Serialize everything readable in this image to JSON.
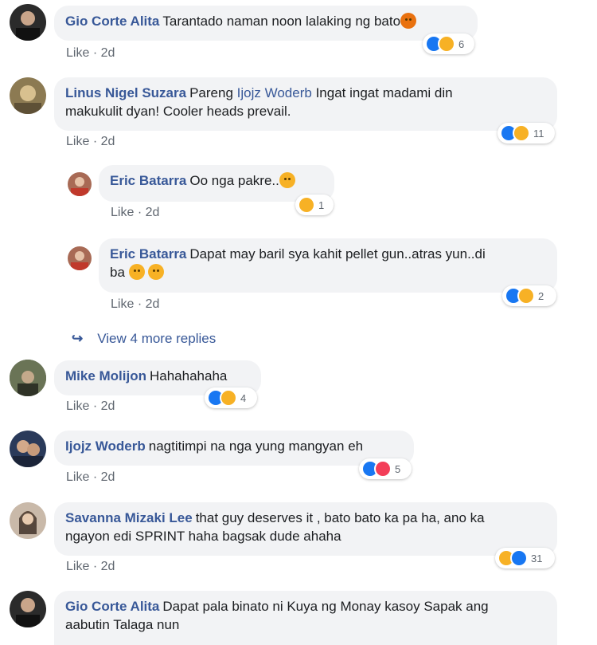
{
  "comments": [
    {
      "name": "Gio Corte Alita",
      "text": "Tarantado naman noon lalaking ng bato",
      "like": "Like",
      "time": "2d",
      "count": "6"
    },
    {
      "name": "Linus Nigel Suzara",
      "pre": "Pareng",
      "mention": "Ijojz Woderb",
      "text": "Ingat ingat madami din",
      "text2": "makukulit dyan! Cooler heads prevail.",
      "like": "Like",
      "time": "2d",
      "count": "11"
    },
    {
      "name": "Eric Batarra",
      "text": "Oo nga pakre..",
      "like": "Like",
      "time": "2d",
      "count": "1"
    },
    {
      "name": "Eric Batarra",
      "text": "Dapat may baril sya kahit pellet gun..atras yun..di",
      "text2": "ba",
      "like": "Like",
      "time": "2d",
      "count": "2"
    },
    {
      "name": "Mike Molijon",
      "text": "Hahahahaha",
      "like": "Like",
      "time": "2d",
      "count": "4"
    },
    {
      "name": "Ijojz Woderb",
      "text": "nagtitimpi na nga yung mangyan eh",
      "like": "Like",
      "time": "2d",
      "count": "5"
    },
    {
      "name": "Savanna Mizaki Lee",
      "text": "that guy deserves it , bato bato ka pa ha, ano ka",
      "text2": "ngayon edi SPRINT haha bagsak dude ahaha",
      "like": "Like",
      "time": "2d",
      "count": "31"
    },
    {
      "name": "Gio Corte Alita",
      "text": "Dapat pala binato ni Kuya ng Monay kasoy Sapak ang",
      "text2": "aabutin Talaga nun"
    }
  ],
  "view_more": {
    "arrow": "↪",
    "label": "View 4 more replies"
  },
  "sep": "·"
}
